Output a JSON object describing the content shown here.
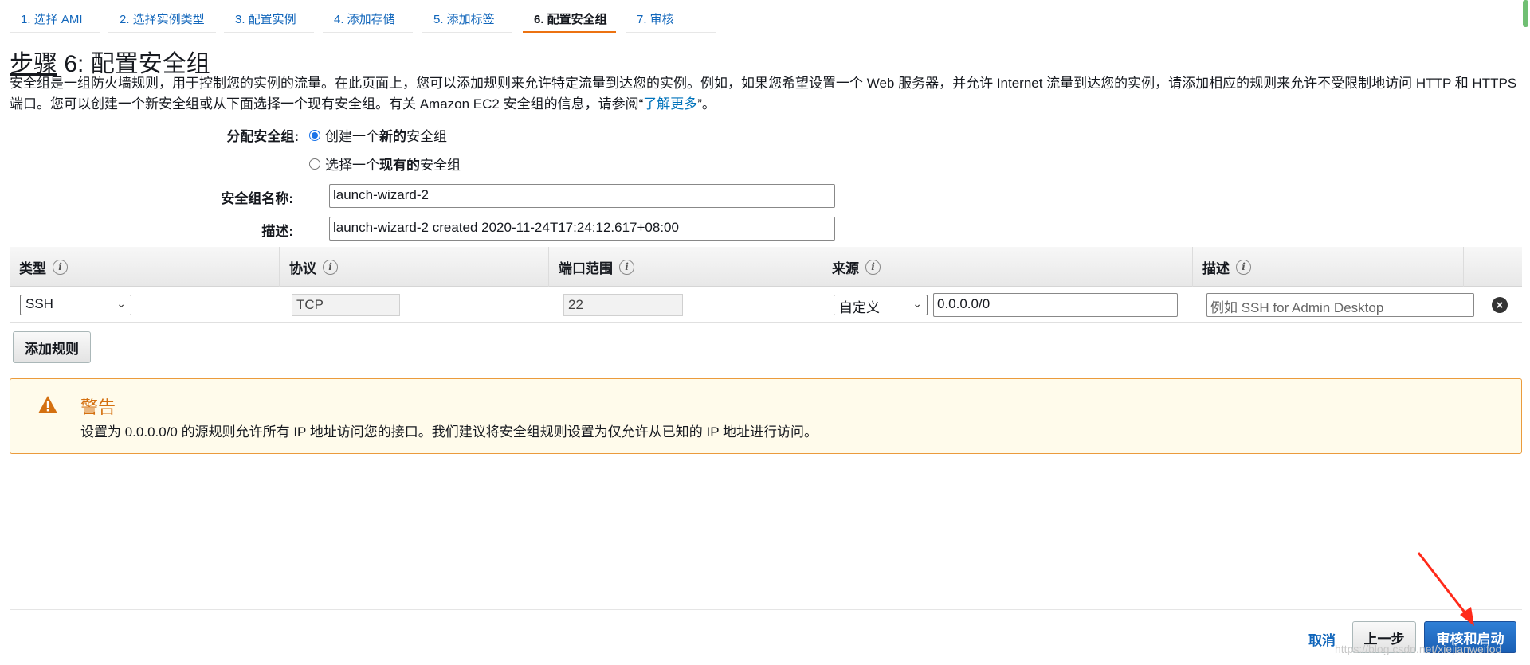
{
  "tabs": [
    {
      "label": "1. 选择 AMI",
      "active": false
    },
    {
      "label": "2. 选择实例类型",
      "active": false
    },
    {
      "label": "3. 配置实例",
      "active": false
    },
    {
      "label": "4. 添加存储",
      "active": false
    },
    {
      "label": "5. 添加标签",
      "active": false
    },
    {
      "label": "6. 配置安全组",
      "active": true
    },
    {
      "label": "7. 审核",
      "active": false
    }
  ],
  "step_title_part1": "步骤",
  "step_title_part2": " 6: 配置安全组",
  "intro": {
    "text": "安全组是一组防火墙规则，用于控制您的实例的流量。在此页面上，您可以添加规则来允许特定流量到达您的实例。例如，如果您希望设置一个 Web 服务器，并允许 Internet 流量到达您的实例，请添加相应的规则来允许不受限制地访问 HTTP 和 HTTPS 端口。您可以创建一个新安全组或从下面选择一个现有安全组。有关 Amazon EC2 安全组的信息，请参阅“",
    "link": "了解更多",
    "tail": "”。"
  },
  "assign": {
    "label": "分配安全组:",
    "option_new": {
      "pre": "创建一个",
      "bold": "新的",
      "post": "安全组",
      "checked": true
    },
    "option_existing": {
      "pre": "选择一个",
      "bold": "现有的",
      "post": "安全组",
      "checked": false
    }
  },
  "group_name": {
    "label": "安全组名称:",
    "value": "launch-wizard-2"
  },
  "description": {
    "label": "描述:",
    "value": "launch-wizard-2 created 2020-11-24T17:24:12.617+08:00"
  },
  "table": {
    "columns": [
      "类型",
      "协议",
      "端口范围",
      "来源",
      "描述"
    ],
    "info_glyph": "i",
    "rows": [
      {
        "type": "SSH",
        "protocol": "TCP",
        "port": "22",
        "source_mode": "自定义",
        "source_value": "0.0.0.0/0",
        "desc_placeholder": "例如 SSH for Admin Desktop"
      }
    ]
  },
  "add_rule_label": "添加规则",
  "warning": {
    "title": "警告",
    "text": "设置为 0.0.0.0/0 的源规则允许所有 IP 地址访问您的接口。我们建议将安全组规则设置为仅允许从已知的 IP 地址进行访问。"
  },
  "footer": {
    "cancel": "取消",
    "previous": "上一步",
    "review_launch": "审核和启动"
  },
  "watermark": "https://blog.csdn.net/xiejianweifod",
  "colors": {
    "accent_tab": "#ec7211",
    "link": "#1166bb",
    "primary_button": "#1a5fb4",
    "warning_border": "#eb9b3c",
    "warning_bg": "#fffbeb",
    "annotation_arrow": "#ff2a1a"
  }
}
